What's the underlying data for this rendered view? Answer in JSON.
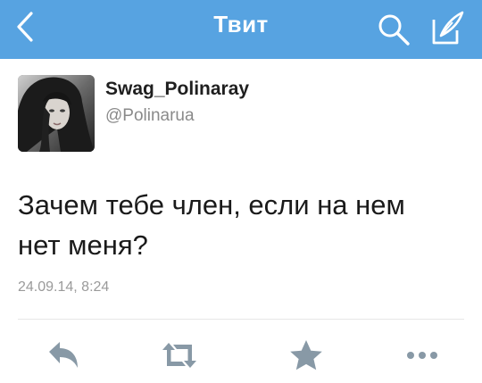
{
  "header": {
    "title": "Твит",
    "back_icon": "chevron-left-icon",
    "search_icon": "search-icon",
    "compose_icon": "compose-icon",
    "bar_color": "#57a3e1"
  },
  "tweet": {
    "display_name": "Swag_Polinaray",
    "handle": "@Polinarua",
    "text_line1": "Зачем тебе член, если на нем",
    "text_line2": "нет меня?",
    "timestamp": "24.09.14, 8:24"
  },
  "actions": {
    "reply_icon": "reply-icon",
    "retweet_icon": "retweet-icon",
    "favorite_icon": "star-icon",
    "more_icon": "more-icon",
    "icon_color": "#8899a6"
  }
}
